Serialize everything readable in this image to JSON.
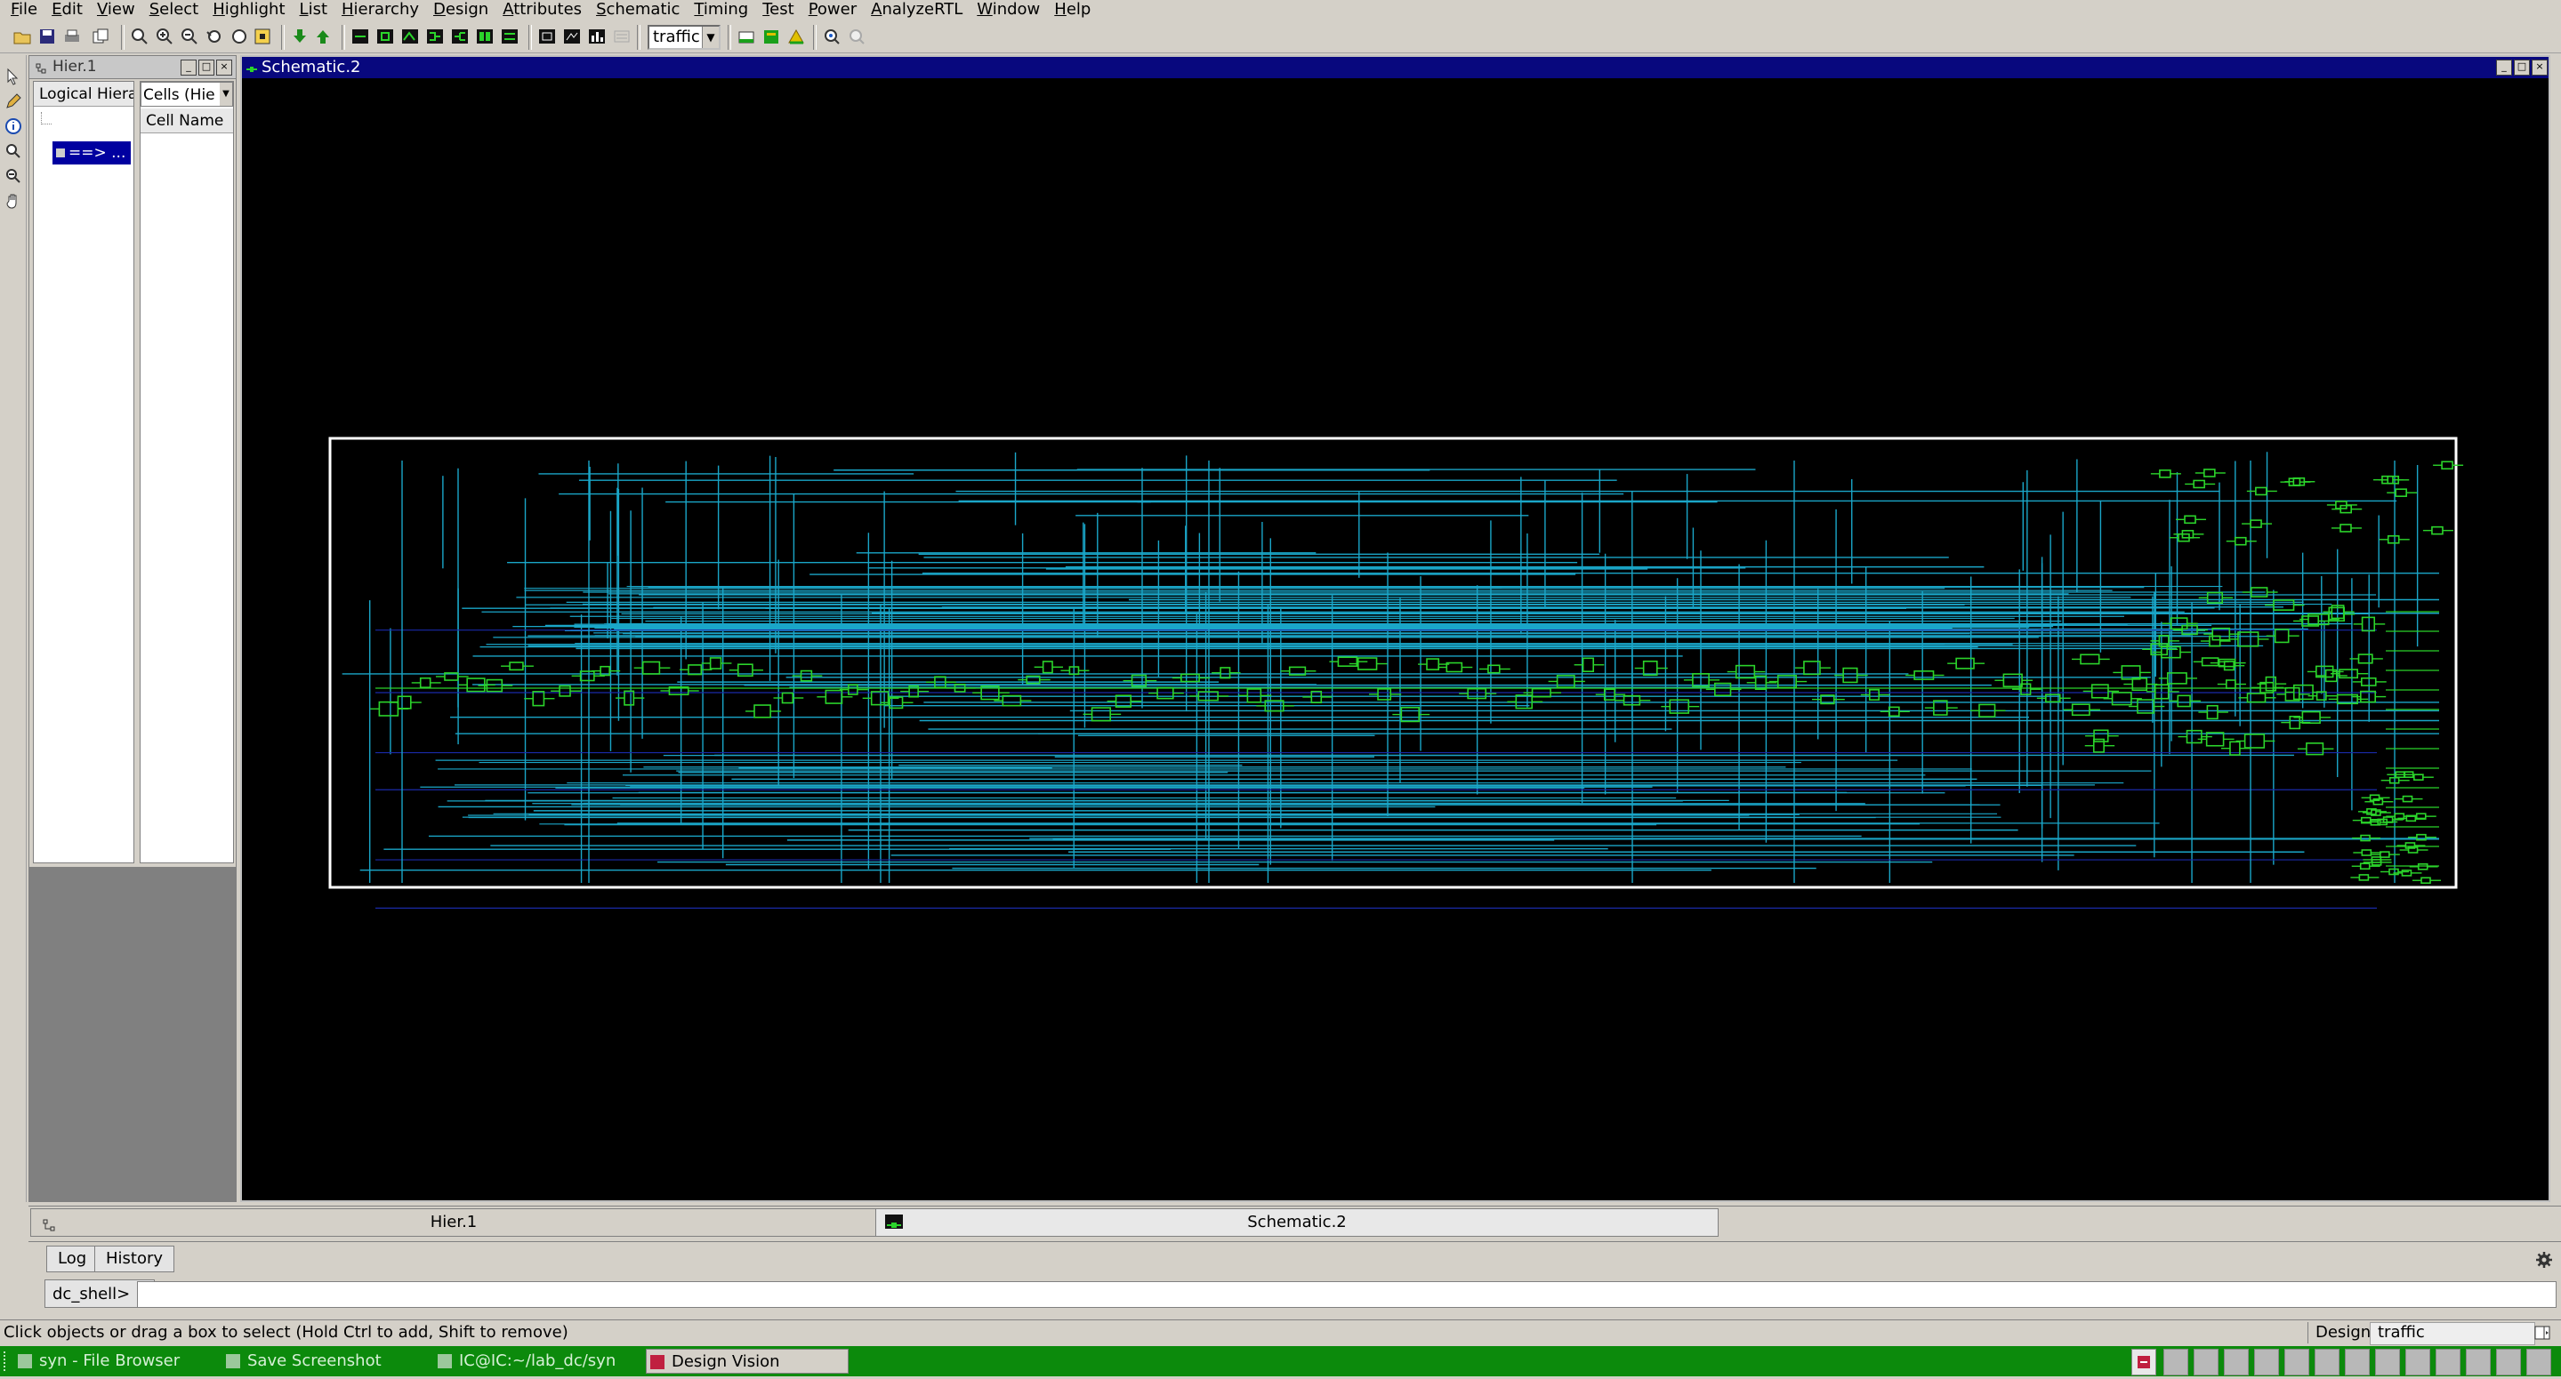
{
  "menu": [
    "File",
    "Edit",
    "View",
    "Select",
    "Highlight",
    "List",
    "Hierarchy",
    "Design",
    "Attributes",
    "Schematic",
    "Timing",
    "Test",
    "Power",
    "AnalyzeRTL",
    "Window",
    "Help"
  ],
  "toolbar": {
    "design_select": "traffic"
  },
  "hier": {
    "title": "Hier.1",
    "col_left": "Logical Hiera",
    "col_right_select": "Cells (Hie",
    "col_right_header": "Cell Name",
    "tree_item": "==> ..."
  },
  "schematic": {
    "title": "Schematic.2"
  },
  "tabs": {
    "hier": "Hier.1",
    "schematic": "Schematic.2"
  },
  "console": {
    "tab_log": "Log",
    "tab_history": "History",
    "prompt": "dc_shell>",
    "input_value": ""
  },
  "status": {
    "message": "Click objects or drag a box to select (Hold Ctrl to add, Shift to remove)",
    "design_label": "Design",
    "design_value": "traffic"
  },
  "taskbar": [
    {
      "label": "syn - File Browser",
      "icon": "folder-icon"
    },
    {
      "label": "Save Screenshot",
      "icon": "camera-icon"
    },
    {
      "label": "IC@IC:~/lab_dc/syn",
      "icon": "terminal-icon"
    },
    {
      "label": "Design Vision",
      "icon": "app-icon"
    }
  ],
  "colors": {
    "title_bar": "#08087e",
    "schematic_bg": "#000000",
    "wire": "#1aa6c8",
    "cell": "#2bd42b",
    "taskbar": "#0c8a0c"
  }
}
